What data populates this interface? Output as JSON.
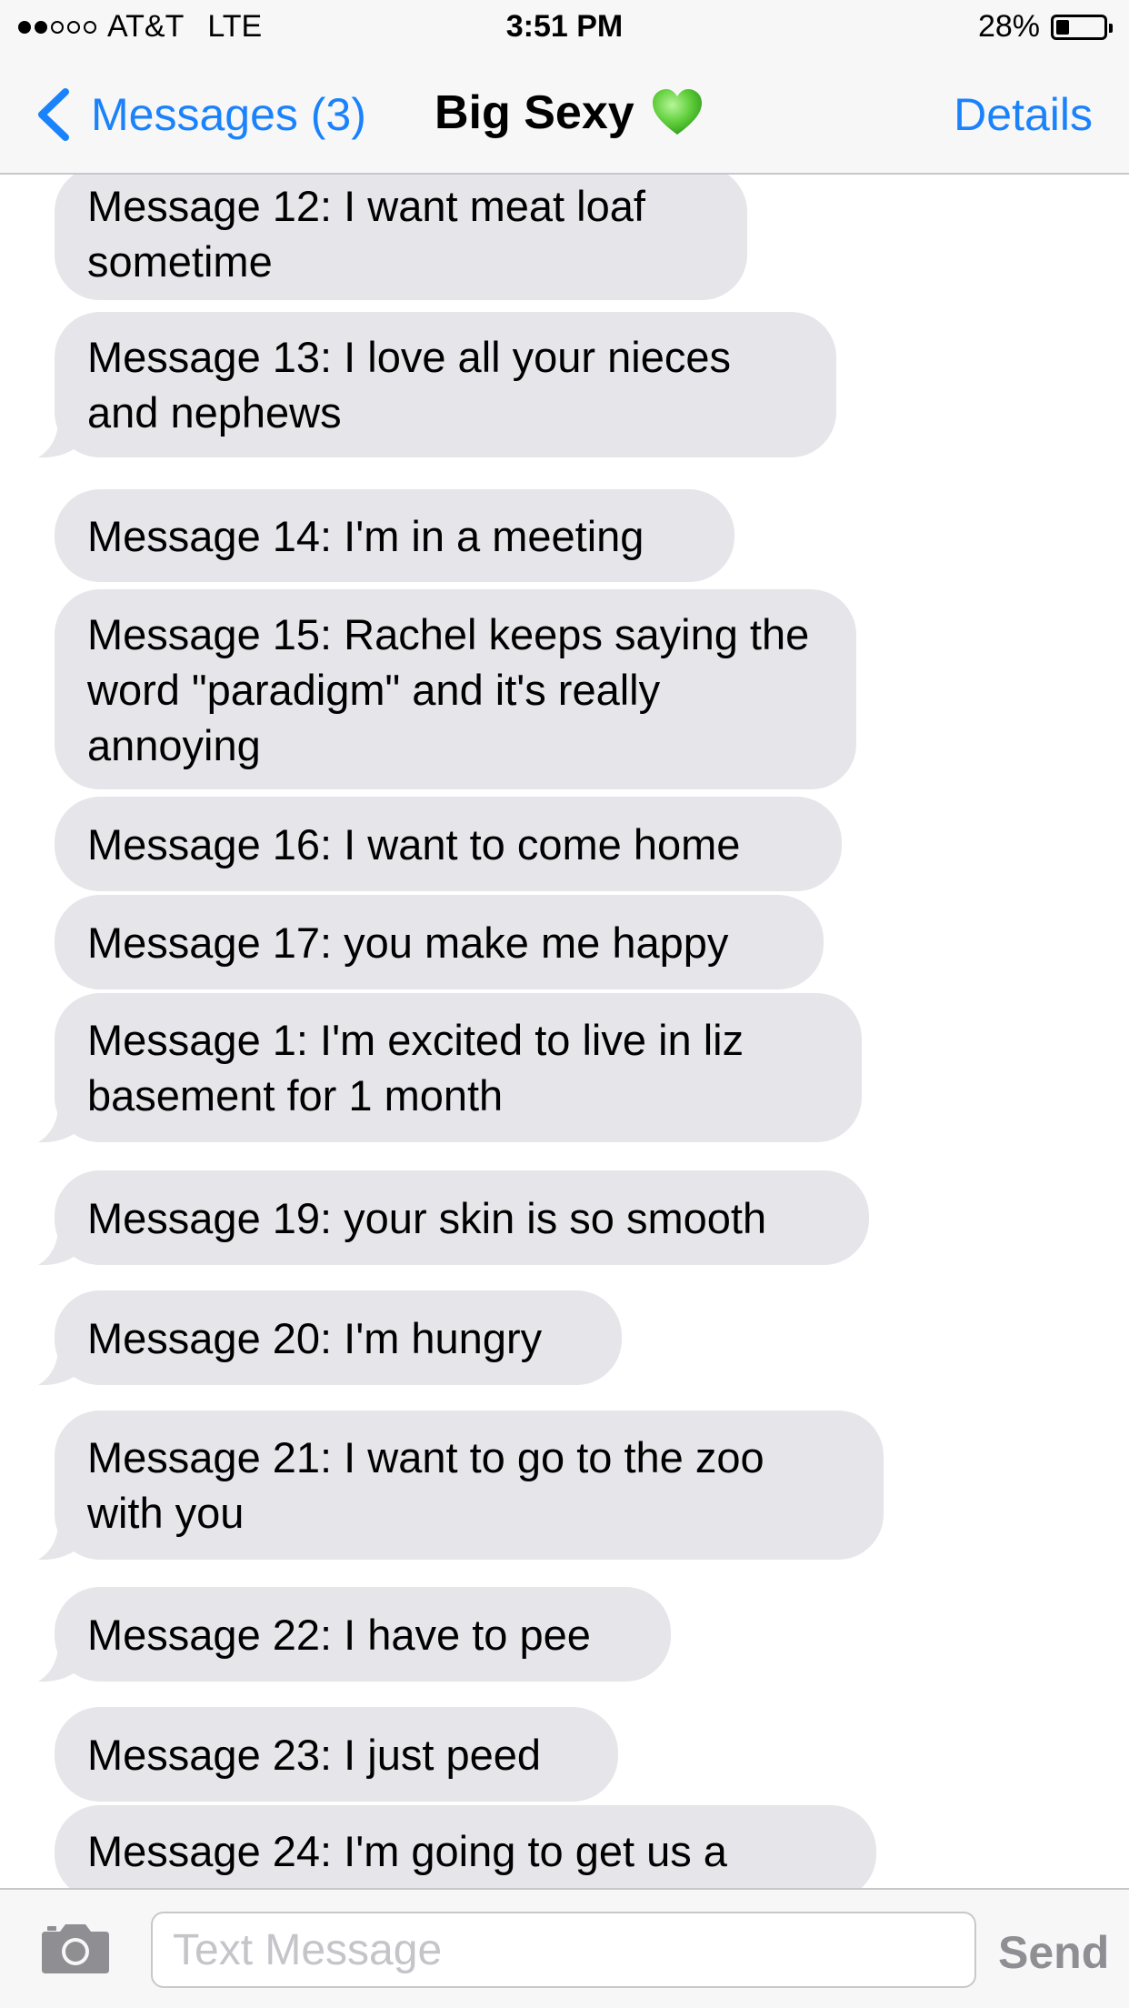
{
  "status_bar": {
    "carrier": "AT&T",
    "network": "LTE",
    "time": "3:51 PM",
    "battery": "28%",
    "battery_level": 0.28,
    "signal_bars": 2
  },
  "nav": {
    "back_label": "Messages (3)",
    "title": "Big Sexy",
    "title_emoji": "green-heart-icon",
    "details_label": "Details"
  },
  "messages": [
    {
      "text": "Message 12: I want meat loaf sometime",
      "tail": false
    },
    {
      "text": "Message 13: I love all your nieces and nephews",
      "tail": true
    },
    {
      "text": "Message 14: I'm in a meeting",
      "tail": false
    },
    {
      "text": "Message 15: Rachel keeps saying the word \"paradigm\" and it's really annoying",
      "tail": false
    },
    {
      "text": "Message 16: I want to come home",
      "tail": false
    },
    {
      "text": "Message 17: you make me happy",
      "tail": false
    },
    {
      "text": "Message 1: I'm excited to live in liz basement for 1 month",
      "tail": true
    },
    {
      "text": "Message 19: your skin is so smooth",
      "tail": true
    },
    {
      "text": "Message 20: I'm hungry",
      "tail": true
    },
    {
      "text": "Message 21: I want to go to the zoo with you",
      "tail": true
    },
    {
      "text": "Message 22: I have to pee",
      "tail": true
    },
    {
      "text": "Message 23: I just peed",
      "tail": false
    },
    {
      "text": "Message 24: I'm going to get us a",
      "tail": false
    }
  ],
  "composer": {
    "placeholder": "Text Message",
    "value": "",
    "send_label": "Send"
  },
  "colors": {
    "accent": "#1a82fb",
    "bubble_gray": "#e5e5ea",
    "bar_bg": "#f7f7f8",
    "heart": "#5fce3a"
  }
}
